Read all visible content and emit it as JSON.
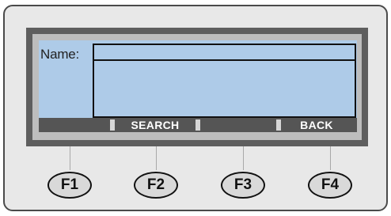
{
  "screen": {
    "name_label": "Name:",
    "name_value": ""
  },
  "softkeys": [
    {
      "label": ""
    },
    {
      "label": "SEARCH"
    },
    {
      "label": ""
    },
    {
      "label": "BACK"
    }
  ],
  "function_keys": [
    {
      "label": "F1"
    },
    {
      "label": "F2"
    },
    {
      "label": "F3"
    },
    {
      "label": "F4"
    }
  ],
  "colors": {
    "lcd_background": "#aecbe8",
    "softkey_bar": "#555555",
    "bezel_dark": "#5e5e5e",
    "bezel_light": "#bdbdbd",
    "device_body": "#e8e8e8"
  }
}
